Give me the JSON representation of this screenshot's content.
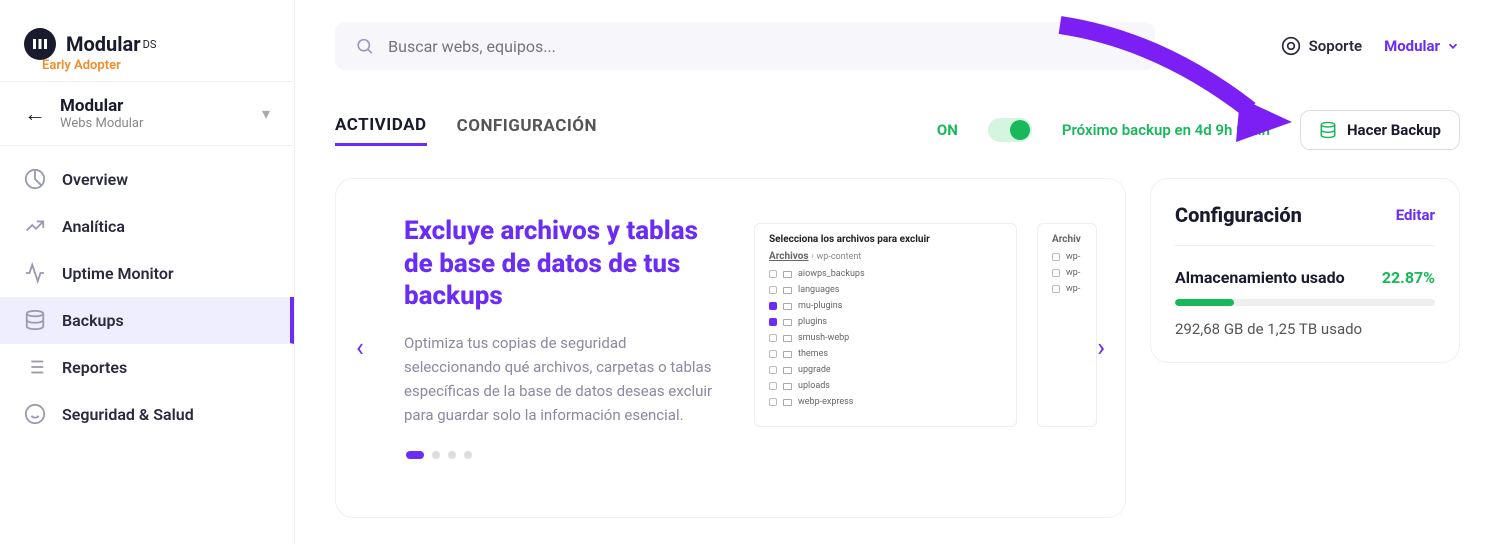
{
  "brand": {
    "name": "Modular",
    "suffix": "DS",
    "subtitle": "Early Adopter"
  },
  "siteSelector": {
    "name": "Modular",
    "sub": "Webs Modular"
  },
  "nav": [
    {
      "label": "Overview",
      "icon": "pie"
    },
    {
      "label": "Analítica",
      "icon": "trend"
    },
    {
      "label": "Uptime Monitor",
      "icon": "monitor"
    },
    {
      "label": "Backups",
      "icon": "db",
      "active": true
    },
    {
      "label": "Reportes",
      "icon": "list"
    },
    {
      "label": "Seguridad & Salud",
      "icon": "smile"
    }
  ],
  "search": {
    "placeholder": "Buscar webs, equipos..."
  },
  "header": {
    "support": "Soporte",
    "user": "Modular"
  },
  "tabs": {
    "activity": "ACTIVIDAD",
    "config": "CONFIGURACIÓN"
  },
  "status": {
    "on": "ON",
    "next": "Próximo backup en 4d 9h 9min"
  },
  "backupBtn": "Hacer Backup",
  "carousel": {
    "title": "Excluye archivos y tablas de base de datos de tus backups",
    "desc": "Optimiza tus copias de seguridad seleccionando qué archivos, carpetas o tablas específicas de la base de datos deseas excluir para guardar solo la información esencial.",
    "panel": {
      "heading": "Selecciona los archivos para excluir",
      "leftTitle": "Archivos",
      "bc": "wp-content",
      "rightTitle": "Archiv",
      "filesLeft": [
        "aiowps_backups",
        "languages",
        "mu-plugins",
        "plugins",
        "smush-webp",
        "themes",
        "upgrade",
        "uploads",
        "webp-express"
      ],
      "checked": [
        2,
        3
      ],
      "filesRight": [
        "wp-",
        "wp-",
        "wp-"
      ]
    }
  },
  "config": {
    "title": "Configuración",
    "edit": "Editar",
    "storageLabel": "Almacenamiento usado",
    "pct": "22.87%",
    "detail": "292,68 GB de 1,25 TB usado"
  }
}
